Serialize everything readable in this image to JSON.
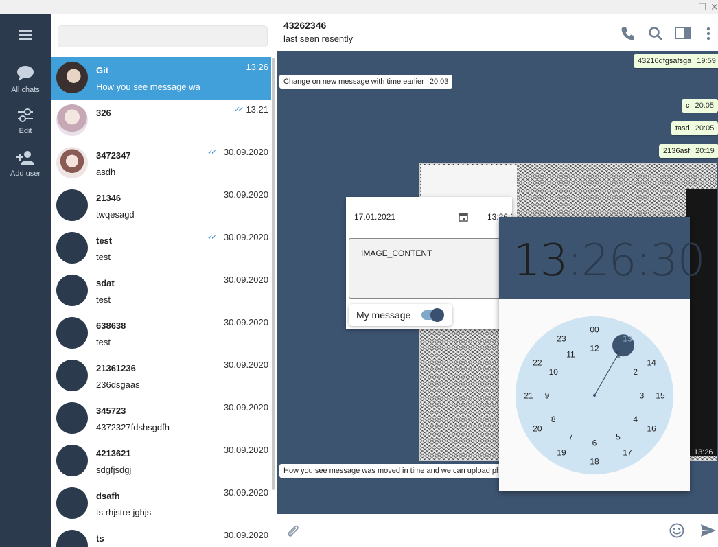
{
  "window": {
    "minimize": "—",
    "maximize": "☐",
    "close": "✕"
  },
  "rail": {
    "items": [
      {
        "label": "All chats",
        "icon": "chat-bubble-icon"
      },
      {
        "label": "Edit",
        "icon": "sliders-icon"
      },
      {
        "label": "Add user",
        "icon": "add-user-icon"
      }
    ]
  },
  "search": {
    "placeholder": ""
  },
  "chats": [
    {
      "name": "Git",
      "preview": "How you see message was moved",
      "time": "13:26",
      "read": false,
      "active": true,
      "avatar": "pic1"
    },
    {
      "name": "326",
      "preview": "",
      "time": "13:21",
      "read": true,
      "active": false,
      "avatar": "pic2"
    },
    {
      "name": "3472347",
      "preview": "asdh",
      "time": "30.09.2020",
      "read": true,
      "active": false,
      "avatar": "pic3"
    },
    {
      "name": "21346",
      "preview": "twqesagd",
      "time": "30.09.2020",
      "read": false,
      "active": false,
      "avatar": ""
    },
    {
      "name": "test",
      "preview": "test",
      "time": "30.09.2020",
      "read": true,
      "active": false,
      "avatar": ""
    },
    {
      "name": "sdat",
      "preview": "test",
      "time": "30.09.2020",
      "read": false,
      "active": false,
      "avatar": ""
    },
    {
      "name": "638638",
      "preview": "test",
      "time": "30.09.2020",
      "read": false,
      "active": false,
      "avatar": ""
    },
    {
      "name": "21361236",
      "preview": "236dsgaas",
      "time": "30.09.2020",
      "read": false,
      "active": false,
      "avatar": ""
    },
    {
      "name": "345723",
      "preview": "4372327fdshsgdfh",
      "time": "30.09.2020",
      "read": false,
      "active": false,
      "avatar": ""
    },
    {
      "name": "4213621",
      "preview": "sdgfjsdgj",
      "time": "30.09.2020",
      "read": false,
      "active": false,
      "avatar": ""
    },
    {
      "name": "dsafh",
      "preview": "ts rhjstre jghjs",
      "time": "30.09.2020",
      "read": false,
      "active": false,
      "avatar": ""
    },
    {
      "name": "ts",
      "preview": "",
      "time": "30.09.2020",
      "read": false,
      "active": false,
      "avatar": ""
    }
  ],
  "header": {
    "title": "43262346",
    "subtitle": "last seen resently"
  },
  "messages": [
    {
      "text": "43216dfgsafsga",
      "time": "19:59",
      "out": true
    },
    {
      "text": "Change on new message with time earlier",
      "time": "20:03",
      "out": false
    },
    {
      "text": "c",
      "time": "20:05",
      "out": true
    },
    {
      "text": "tasd",
      "time": "20:05",
      "out": true
    },
    {
      "text": "2136asf",
      "time": "20:19",
      "out": true
    },
    {
      "text": "How you see message was moved in time and we can upload pho",
      "time": "",
      "out": false
    }
  ],
  "photo": {
    "time": "13:26"
  },
  "editor": {
    "date": "17.01.2021",
    "time": "13:26:30",
    "content": "IMAGE_CONTENT",
    "toggle_label": "My message",
    "toggle_on": true
  },
  "clock": {
    "display_h": "13",
    "display_sep1": ":",
    "display_m": "26",
    "display_sep2": ":",
    "display_s": "30",
    "selected_hour": "13",
    "outer": [
      "00",
      "13",
      "14",
      "15",
      "16",
      "17",
      "18",
      "19",
      "20",
      "21",
      "22",
      "23"
    ],
    "inner": [
      "12",
      "1",
      "2",
      "3",
      "4",
      "5",
      "6",
      "7",
      "8",
      "9",
      "10",
      "11"
    ],
    "accent": "#3d5470",
    "face": "#cfe4f3"
  },
  "colors": {
    "active_chat": "#419fd9",
    "chat_bg": "#3d5470",
    "rail": "#2c3a4d"
  }
}
